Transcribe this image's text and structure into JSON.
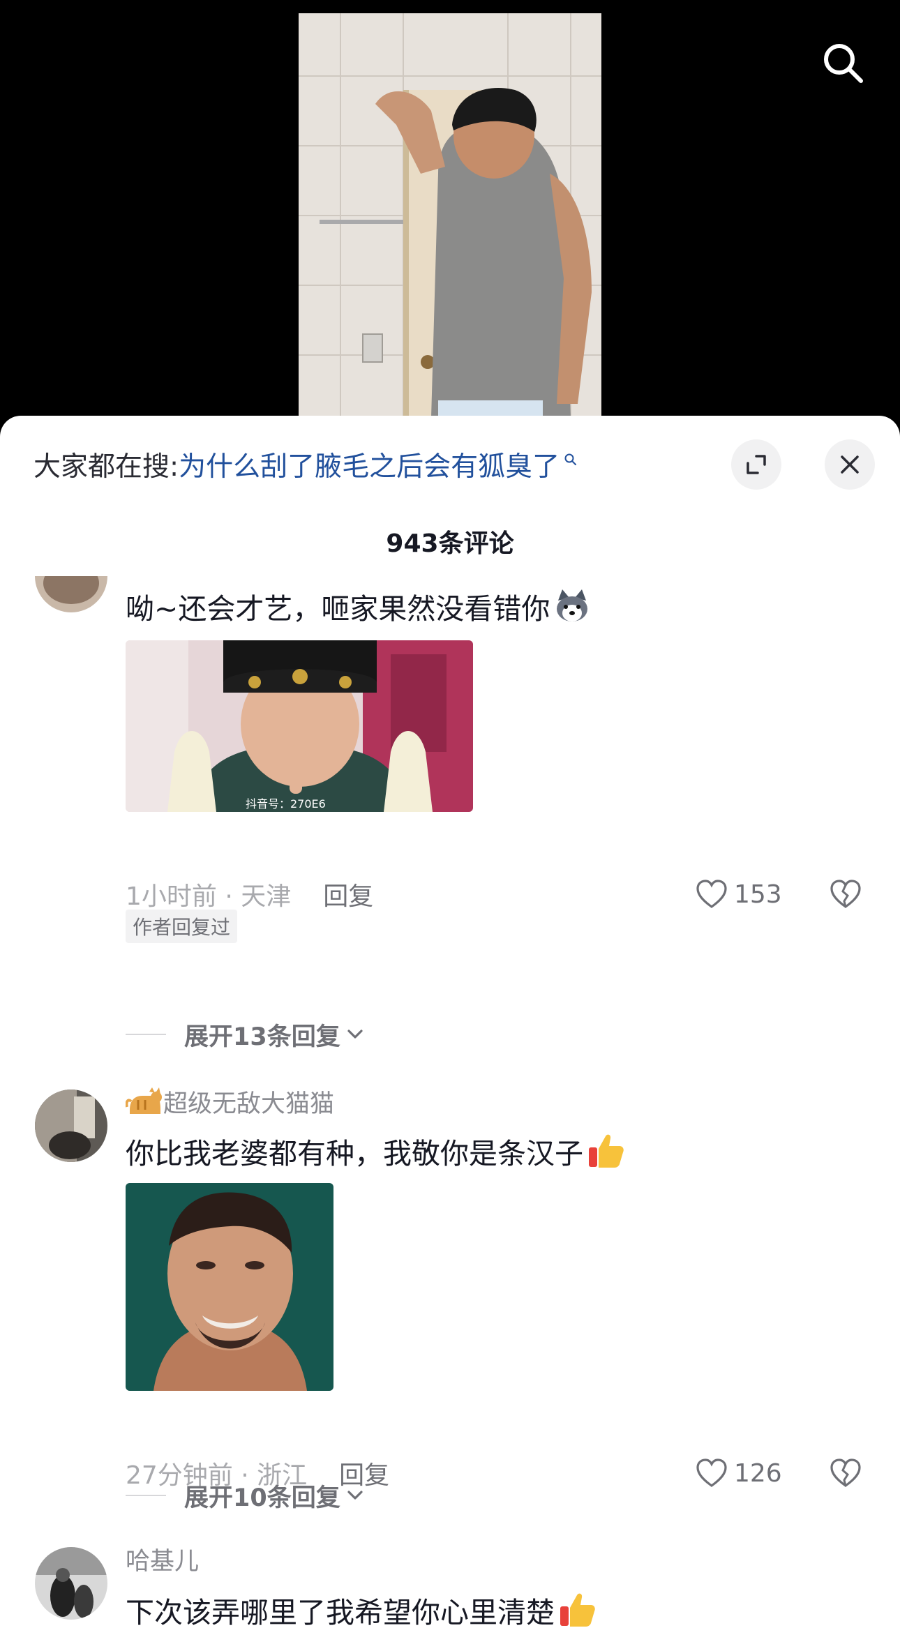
{
  "icons": {
    "search": "search-icon",
    "expand": "expand-icon",
    "close": "close-icon",
    "heart": "heart-icon",
    "dislike": "broken-heart-icon",
    "chevron": "chevron-down-icon"
  },
  "search_bar": {
    "prefix": "大家都在搜:",
    "query": "为什么刮了腋毛之后会有狐臭了"
  },
  "comments_title": "943条评论",
  "comments": [
    {
      "text": "呦~还会才艺，咂家果然没看错你",
      "image_watermark": "抖音号：270E6",
      "time_location": "1小时前 · 天津",
      "reply_label": "回复",
      "likes": "153",
      "badge": "作者回复过",
      "expand_label": "展开13条回复"
    },
    {
      "username": "超级无敌大猫猫",
      "text": "你比我老婆都有种，我敬你是条汉子",
      "time_location": "27分钟前 · 浙江",
      "reply_label": "回复",
      "likes": "126",
      "expand_label": "展开10条回复"
    },
    {
      "username": "哈基儿",
      "text": "下次该弄哪里了我希望你心里清楚"
    }
  ],
  "colors": {
    "link_blue": "#21509c",
    "muted_gray": "#a8a9ad",
    "text_dark": "#161823"
  }
}
